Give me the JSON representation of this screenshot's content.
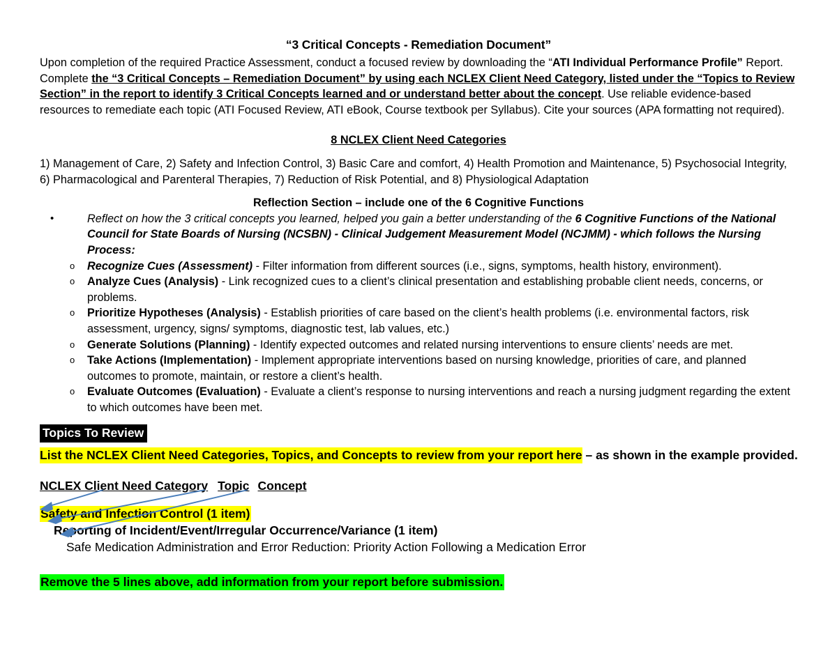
{
  "document": {
    "title": "“3 Critical Concepts - Remediation Document”",
    "intro": {
      "p1_a": "Upon completion of the required Practice Assessment, conduct a focused review by downloading the “",
      "p1_bold": "ATI Individual Performance Profile”",
      "p1_b": " Report.",
      "p2_a": "Complete ",
      "p2_bold_underline": "the “3 Critical Concepts – Remediation Document” by using each NCLEX Client Need Category, listed under the “Topics to Review Section” in the report to identify 3 Critical Concepts learned and or understand better about the concept",
      "p2_b": ".  Use reliable evidence-based resources to remediate each topic (ATI Focused Review, ATI eBook, Course textbook per Syllabus). Cite your sources (APA formatting not required)."
    },
    "categories_section": {
      "heading": "8 NCLEX Client Need Categories",
      "body": "1) Management of Care, 2) Safety and Infection Control, 3) Basic Care and comfort, 4) Health Promotion and Maintenance, 5) Psychosocial Integrity, 6) Pharmacological and Parenteral Therapies, 7) Reduction of Risk Potential, and 8) Physiological Adaptation"
    },
    "reflection_section": {
      "heading": "Reflection Section – include one of the 6 Cognitive Functions",
      "bullet_marker": "•",
      "sub_marker": "o",
      "lead_a": "Reflect on how the 3 critical concepts you learned, helped you gain a better understanding of the ",
      "lead_bold": "6 Cognitive Functions of the National Council for State Boards of Nursing (NCSBN) - Clinical Judgement Measurement Model (NCJMM) - which follows the Nursing Process:",
      "items": [
        {
          "term": "Recognize Cues (Assessment)",
          "term_style": "bold-italic-partial",
          "desc": " - Filter information from different sources (i.e., signs, symptoms, health history, environment)."
        },
        {
          "term": "Analyze Cues (Analysis)",
          "term_style": "bold",
          "desc": " - Link recognized cues to a client’s clinical presentation and establishing probable client needs, concerns, or problems."
        },
        {
          "term": "Prioritize Hypotheses (Analysis)",
          "term_style": "bold",
          "desc": " - Establish priorities of care based on the client’s health problems (i.e. environmental factors, risk assessment, urgency, signs/ symptoms, diagnostic test, lab values, etc.)"
        },
        {
          "term": "Generate Solutions (Planning)",
          "term_style": "bold",
          "desc": " - Identify expected outcomes and related nursing interventions to ensure clients’ needs are met."
        },
        {
          "term": "Take Actions (Implementation)",
          "term_style": "bold",
          "desc": " - Implement appropriate interventions based on nursing knowledge, priorities of care, and planned outcomes to promote, maintain, or restore a client’s health."
        },
        {
          "term": "Evaluate Outcomes (Evaluation)",
          "term_style": "bold",
          "desc": " - Evaluate a client’s response to nursing interventions and reach a nursing judgment regarding the extent to which outcomes have been met."
        }
      ]
    },
    "topics_to_review": {
      "banner_label": "Topics To Review",
      "instruction_highlighted": "List the NCLEX Client Need Categories, Topics, and Concepts to review from your report here",
      "instruction_rest": " – as shown in the example provided.",
      "column_headers": {
        "category": "NCLEX Client Need Category",
        "topic": "Topic",
        "concept": "Concept"
      },
      "example": {
        "category_line": "Safety and Infection Control (1 item)",
        "topic_line": "Reporting of Incident/Event/Irregular Occurrence/Variance (1 item)",
        "concept_line": "Safe Medication Administration and Error Reduction: Priority Action Following a Medication Error"
      },
      "remove_note": "Remove the 5 lines above, add information from your report before submission."
    },
    "colors": {
      "highlight_yellow": "#FFFF00",
      "highlight_green": "#00FF00",
      "banner_black": "#000000",
      "banner_text": "#FFFFFF",
      "arrow_blue": "#4A7EBB",
      "text": "#000000",
      "page_background": "#FFFFFF"
    },
    "annotations": {
      "arrows": [
        {
          "name": "arrow-category",
          "from": "NCLEX Client Need Category header",
          "to": "Safety and Infection Control (1 item)"
        },
        {
          "name": "arrow-topic",
          "from": "Topic header",
          "to": "Reporting of Incident/Event/Irregular Occurrence/Variance (1 item)"
        },
        {
          "name": "arrow-concept",
          "from": "Concept header",
          "to": "Safe Medication Administration and Error Reduction"
        }
      ]
    }
  }
}
